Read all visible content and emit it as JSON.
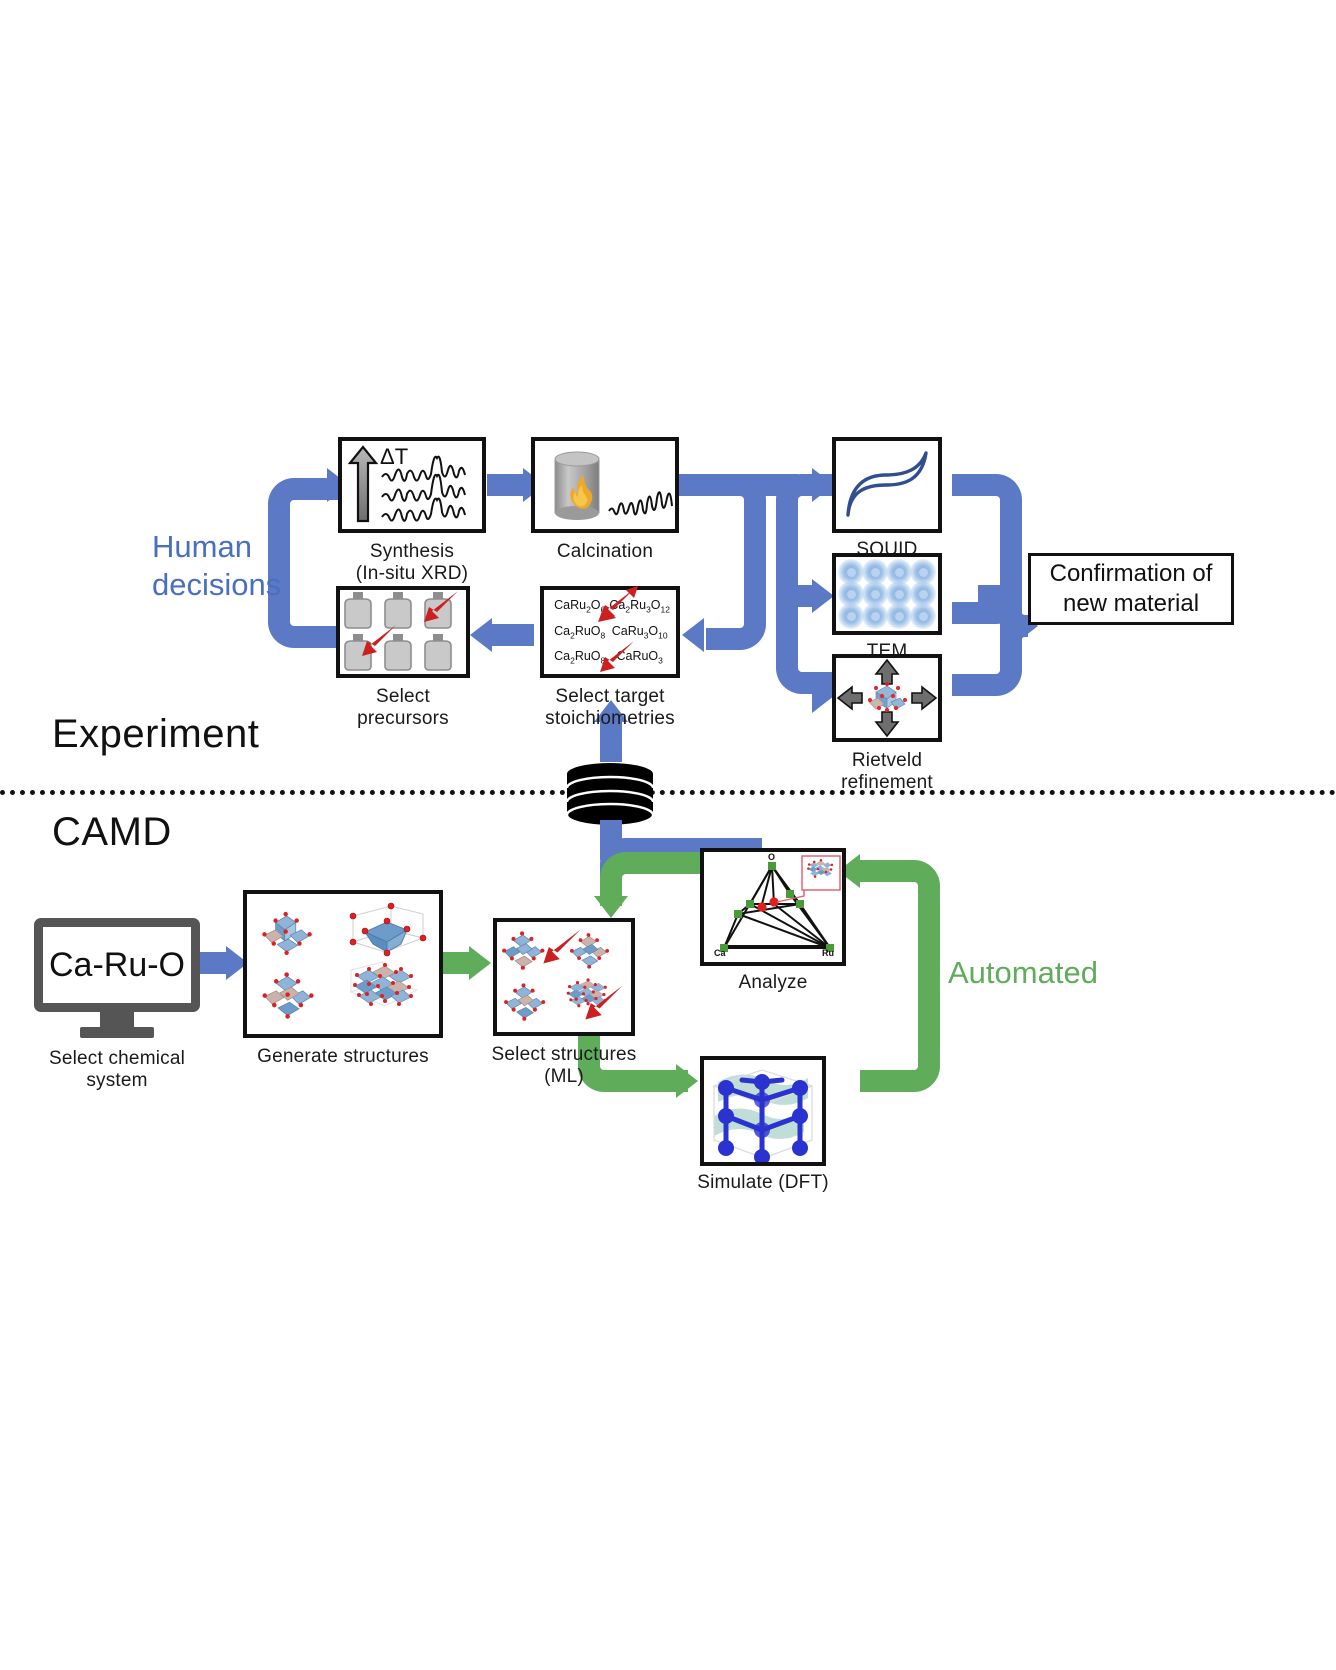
{
  "figure": {
    "sections": {
      "experiment_label": "Experiment",
      "camd_label": "CAMD"
    },
    "annotations": {
      "human_decisions_line1": "Human",
      "human_decisions_line2": "decisions",
      "automated": "Automated"
    },
    "colors": {
      "human_flow": "#5B79C4",
      "automated_flow": "#5FAC5B",
      "red_arrow": "#CC1F1F",
      "box_border": "#111111",
      "monitor_frame": "#555555",
      "tem_blue": "#9CC0E8",
      "dft_blue": "#2A32D0",
      "ternary_green": "#4A9A3A",
      "ternary_red": "#E02020"
    }
  },
  "experiment": {
    "steps": [
      {
        "id": "synthesis",
        "caption_line1": "Synthesis",
        "caption_line2": "(In-situ XRD)",
        "badge": "ΔT"
      },
      {
        "id": "calcination",
        "caption_line1": "Calcination",
        "caption_line2": ""
      },
      {
        "id": "squid",
        "caption_line1": "SQUID",
        "caption_line2": ""
      },
      {
        "id": "tem",
        "caption_line1": "TEM",
        "caption_line2": ""
      },
      {
        "id": "rietveld",
        "caption_line1": "Rietveld",
        "caption_line2": "refinement"
      },
      {
        "id": "select-target-stoichiometries",
        "caption_line1": "Select target",
        "caption_line2": "stoichiometries"
      },
      {
        "id": "select-precursors",
        "caption_line1": "Select",
        "caption_line2": "precursors"
      }
    ],
    "stoichiometries": [
      "CaRu2O6",
      "Ca2Ru3O12",
      "Ca2RuO8",
      "CaRu3O10",
      "Ca2RuO8",
      "CaRuO3"
    ],
    "stoichiometries_html": [
      "CaRu<sub>2</sub>O<sub>6</sub>",
      "Ca<sub>2</sub>Ru<sub>3</sub>O<sub>12</sub>",
      "Ca<sub>2</sub>RuO<sub>8</sub>",
      "CaRu<sub>3</sub>O<sub>10</sub>",
      "Ca<sub>2</sub>RuO<sub>8</sub>",
      "CaRuO<sub>3</sub>"
    ],
    "result": {
      "line1": "Confirmation of",
      "line2": "new material"
    }
  },
  "camd": {
    "monitor_text": "Ca-Ru-O",
    "steps": [
      {
        "id": "select-chemical-system",
        "caption_line1": "Select chemical",
        "caption_line2": "system"
      },
      {
        "id": "generate-structures",
        "caption_line1": "Generate structures",
        "caption_line2": ""
      },
      {
        "id": "select-structures-ml",
        "caption_line1": "Select structures",
        "caption_line2": "(ML)"
      },
      {
        "id": "analyze",
        "caption_line1": "Analyze",
        "caption_line2": ""
      },
      {
        "id": "simulate-dft",
        "caption_line1": "Simulate (DFT)",
        "caption_line2": ""
      }
    ],
    "ternary_vertices": {
      "top": "O",
      "bottom_left": "Ca",
      "bottom_right": "Ru"
    }
  }
}
